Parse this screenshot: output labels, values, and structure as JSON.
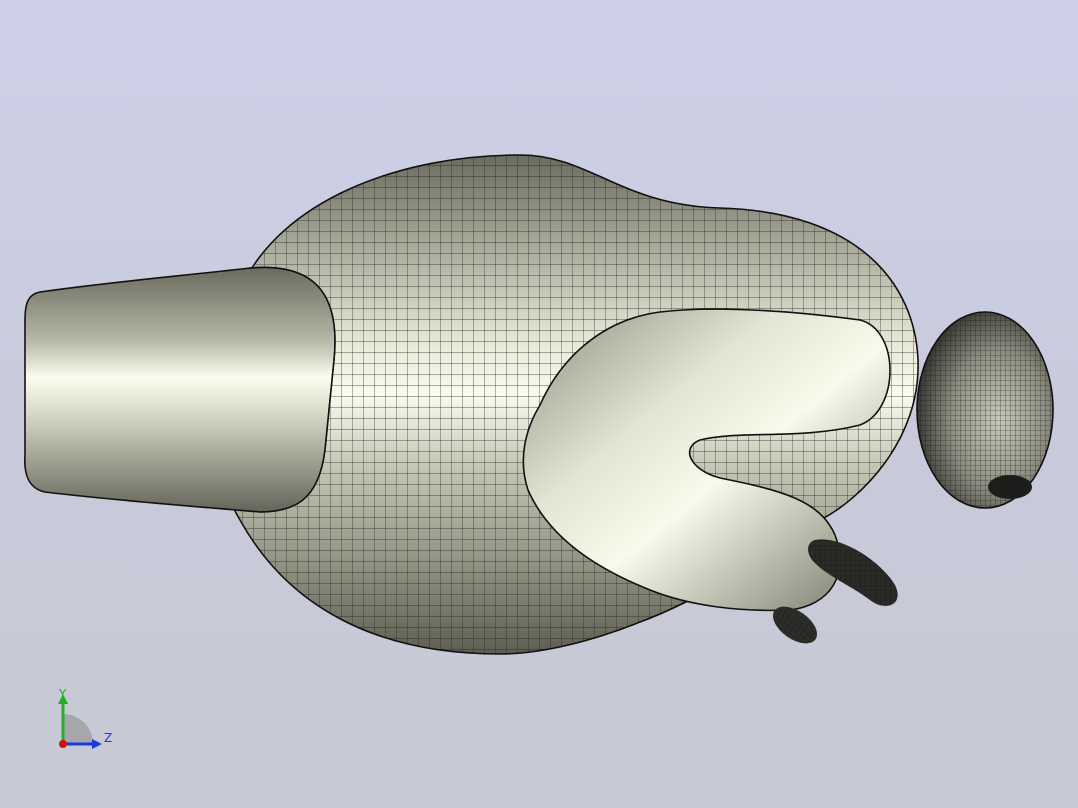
{
  "viewer": {
    "background_top": "#cfd0e8",
    "background_bottom": "#c7c9d4",
    "mesh_color": "#1a1a1a",
    "surface_light": "#f6f6ea",
    "surface_dark": "#6a6a5c"
  },
  "model": {
    "parts": [
      "body",
      "cylindrical-attachment",
      "bent-arm",
      "head",
      "foot-left",
      "foot-right"
    ]
  },
  "triad": {
    "y_label": "Y",
    "z_label": "Z",
    "y_color": "#20b020",
    "z_color": "#1a3adf",
    "x_color": "#d01010"
  }
}
